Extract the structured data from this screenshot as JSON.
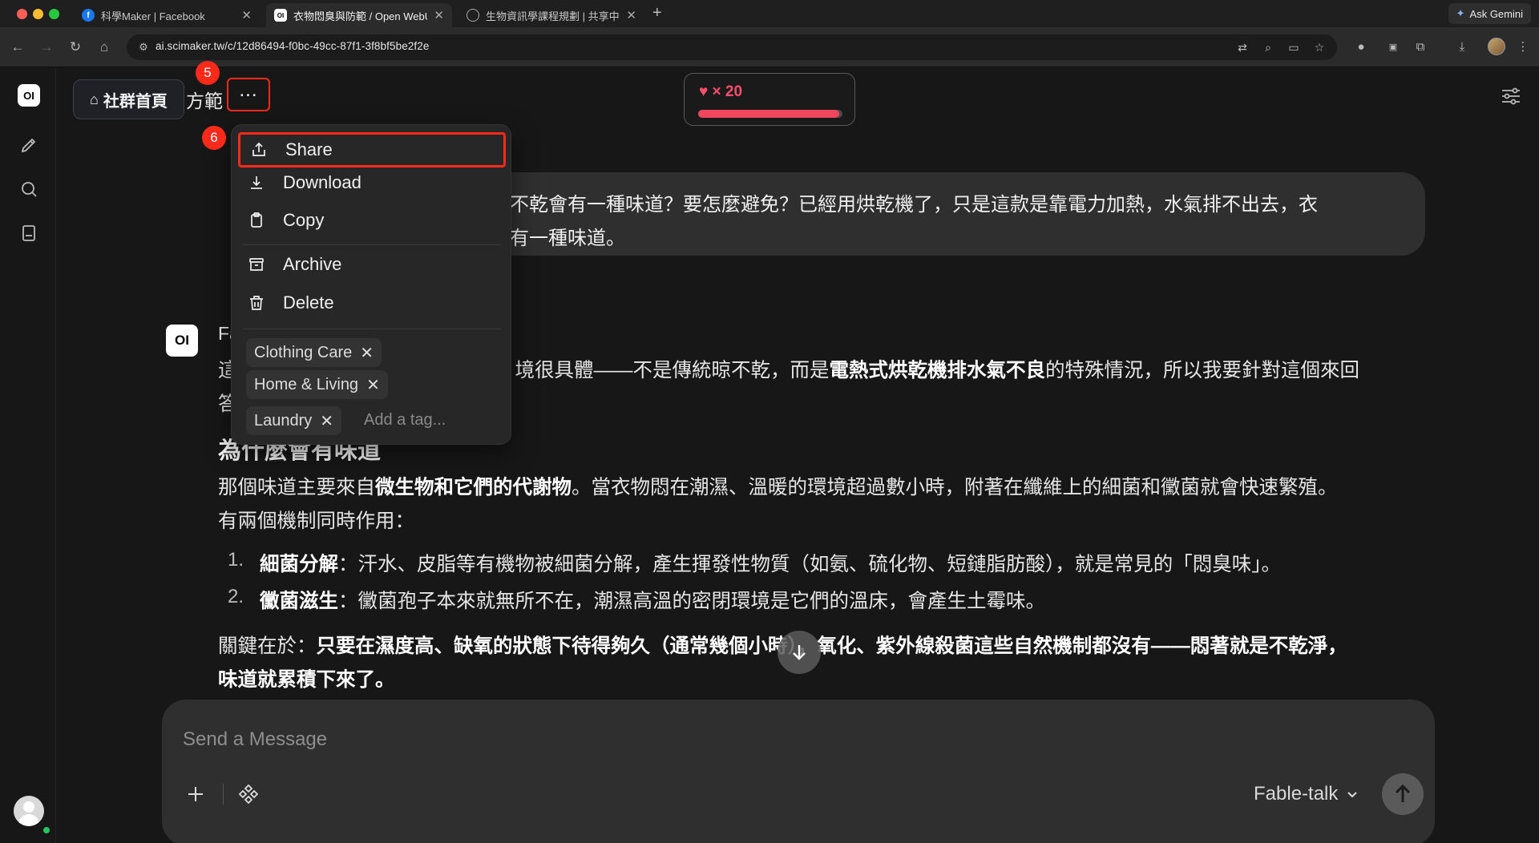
{
  "browser": {
    "tabs": [
      {
        "label": "科學Maker | Facebook",
        "icon": "facebook-icon",
        "active": false
      },
      {
        "label": "衣物悶臭與防範 / Open WebUI",
        "icon": "openwebui-icon",
        "active": true
      },
      {
        "label": "生物資訊學課程規劃 | 共享中心",
        "icon": "globe-icon",
        "active": false
      }
    ],
    "gemini_label": "Ask Gemini",
    "url": "ai.scimaker.tw/c/12d86494-f0bc-49cc-87f1-3f8bf5be2f2e"
  },
  "app": {
    "rail_logo": "OI",
    "community_button": "社群首頁",
    "chat_title_fragment": "方範",
    "hearts": {
      "label": "♥ × 20",
      "fill_fraction": 0.98,
      "color": "#f2455e"
    },
    "step_badges": {
      "more": "5",
      "share": "6"
    },
    "accent_highlight": "#ff2a1a"
  },
  "menu": {
    "items": [
      {
        "label": "Share",
        "icon": "share-icon"
      },
      {
        "label": "Download",
        "icon": "download-icon"
      },
      {
        "label": "Copy",
        "icon": "clipboard-icon"
      },
      {
        "label": "Archive",
        "icon": "archive-icon"
      },
      {
        "label": "Delete",
        "icon": "trash-icon"
      }
    ],
    "tags": [
      "Clothing Care",
      "Home & Living",
      "Laundry"
    ],
    "tag_placeholder": "Add a tag..."
  },
  "conversation": {
    "user_line1": "不乾會有一種味道？要怎麼避免？已經用烘乾機了，只是這款是靠電力加熱，水氣排不出去，衣",
    "user_line2": "有一種味道。",
    "ai_logo": "OI",
    "ai_name": "Fa",
    "ai_intro_a": "這",
    "ai_intro_b": "境很具體——不是傳統晾不乾，而是",
    "ai_intro_bold": "電熱式烘乾機排水氣不良",
    "ai_intro_c": "的特殊情況，所以我要針對這個來回",
    "ai_intro_line2": "答",
    "heading": "為什麼會有味道",
    "p1_a": "那個味道主要來自",
    "p1_bold": "微生物和它們的代謝物",
    "p1_b": "。當衣物悶在潮濕、溫暖的環境超過數小時，附著在纖維上的細菌和黴菌就會快速繁殖。",
    "p1_line2": "有兩個機制同時作用：",
    "list": [
      {
        "num": "1.",
        "bold": "細菌分解",
        "text": "：汗水、皮脂等有機物被細菌分解，產生揮發性物質（如氨、硫化物、短鏈脂肪酸），就是常見的「悶臭味」。"
      },
      {
        "num": "2.",
        "bold": "黴菌滋生",
        "text": "：黴菌孢子本來就無所不在，潮濕高溫的密閉環境是它們的溫床，會產生土霉味。"
      }
    ],
    "key_a": "關鍵在於：",
    "key_bold1": "只要在濕度高、缺氧的狀態下待得夠久（通常幾個小時），氧化、紫外線殺菌這些自然機制都沒有——悶著就是不乾淨，",
    "key_bold2": "味道就累積下來了。"
  },
  "composer": {
    "placeholder": "Send a Message",
    "model": "Fable-talk"
  }
}
